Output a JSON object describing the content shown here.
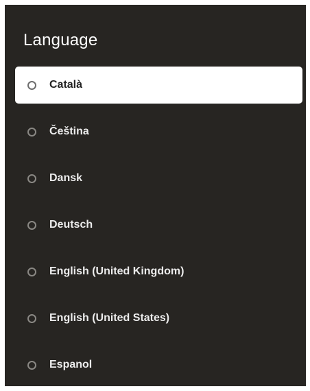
{
  "screen": {
    "title": "Language"
  },
  "languages": [
    {
      "label": "Català",
      "selected": false,
      "focused": true
    },
    {
      "label": "Čeština",
      "selected": false,
      "focused": false
    },
    {
      "label": "Dansk",
      "selected": false,
      "focused": false
    },
    {
      "label": "Deutsch",
      "selected": false,
      "focused": false
    },
    {
      "label": "English (United Kingdom)",
      "selected": false,
      "focused": false
    },
    {
      "label": "English (United States)",
      "selected": false,
      "focused": false
    },
    {
      "label": "Espanol",
      "selected": false,
      "focused": false
    }
  ],
  "colors": {
    "panel_background": "#272522",
    "focus_background": "#ffffff",
    "text_primary": "#ececec",
    "text_focused": "#222222"
  }
}
